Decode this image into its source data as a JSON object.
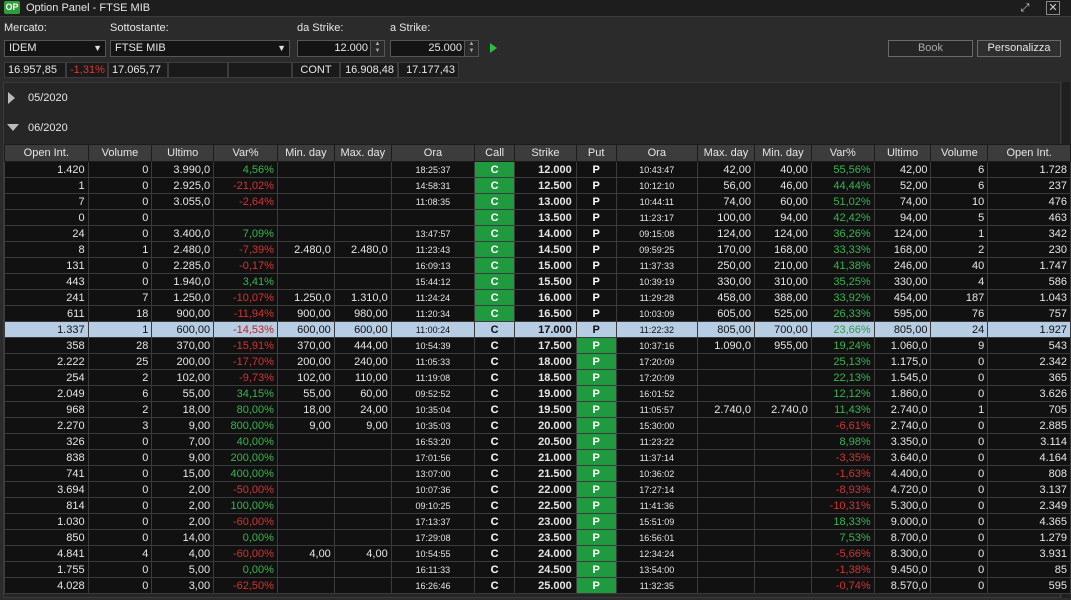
{
  "window": {
    "title": "Option Panel - FTSE MIB",
    "app_icon": "OP"
  },
  "filters": {
    "mercato_label": "Mercato:",
    "mercato_value": "IDEM",
    "sottostante_label": "Sottostante:",
    "sottostante_value": "FTSE MIB",
    "da_strike_label": "da Strike:",
    "da_strike_value": "12.000",
    "a_strike_label": "a Strike:",
    "a_strike_value": "25.000",
    "book_label": "Book",
    "personalizza_label": "Personalizza"
  },
  "quote": {
    "last": "16.957,85",
    "change": "-1,31%",
    "ref": "17.065,77",
    "cont_label": "CONT",
    "bid": "16.908,48",
    "ask": "17.177,43"
  },
  "expiries": [
    {
      "label": "05/2020",
      "expanded": false
    },
    {
      "label": "06/2020",
      "expanded": true
    }
  ],
  "columns": [
    "Open Int.",
    "Volume",
    "Ultimo",
    "Var%",
    "Min. day",
    "Max. day",
    "Ora",
    "Call",
    "Strike",
    "Put",
    "Ora",
    "Max. day",
    "Min. day",
    "Var%",
    "Ultimo",
    "Volume",
    "Open Int."
  ],
  "rows": [
    {
      "c_oi": "1.420",
      "c_vol": "0",
      "c_last": "3.990,0",
      "c_var": "4,56%",
      "c_min": "",
      "c_max": "",
      "c_time": "18:25:37",
      "call": "C",
      "call_itm": true,
      "strike": "12.000",
      "put": "P",
      "put_itm": false,
      "p_time": "10:43:47",
      "p_max": "42,00",
      "p_min": "40,00",
      "p_var": "55,56%",
      "p_last": "42,00",
      "p_vol": "6",
      "p_oi": "1.728"
    },
    {
      "c_oi": "1",
      "c_vol": "0",
      "c_last": "2.925,0",
      "c_var": "-21,02%",
      "c_min": "",
      "c_max": "",
      "c_time": "14:58:31",
      "call": "C",
      "call_itm": true,
      "strike": "12.500",
      "put": "P",
      "put_itm": false,
      "p_time": "10:12:10",
      "p_max": "56,00",
      "p_min": "46,00",
      "p_var": "44,44%",
      "p_last": "52,00",
      "p_vol": "6",
      "p_oi": "237"
    },
    {
      "c_oi": "7",
      "c_vol": "0",
      "c_last": "3.055,0",
      "c_var": "-2,64%",
      "c_min": "",
      "c_max": "",
      "c_time": "11:08:35",
      "call": "C",
      "call_itm": true,
      "strike": "13.000",
      "put": "P",
      "put_itm": false,
      "p_time": "10:44:11",
      "p_max": "74,00",
      "p_min": "60,00",
      "p_var": "51,02%",
      "p_last": "74,00",
      "p_vol": "10",
      "p_oi": "476"
    },
    {
      "c_oi": "0",
      "c_vol": "0",
      "c_last": "",
      "c_var": "",
      "c_min": "",
      "c_max": "",
      "c_time": "",
      "call": "C",
      "call_itm": true,
      "strike": "13.500",
      "put": "P",
      "put_itm": false,
      "p_time": "11:23:17",
      "p_max": "100,00",
      "p_min": "94,00",
      "p_var": "42,42%",
      "p_last": "94,00",
      "p_vol": "5",
      "p_oi": "463"
    },
    {
      "c_oi": "24",
      "c_vol": "0",
      "c_last": "3.400,0",
      "c_var": "7,09%",
      "c_min": "",
      "c_max": "",
      "c_time": "13:47:57",
      "call": "C",
      "call_itm": true,
      "strike": "14.000",
      "put": "P",
      "put_itm": false,
      "p_time": "09:15:08",
      "p_max": "124,00",
      "p_min": "124,00",
      "p_var": "36,26%",
      "p_last": "124,00",
      "p_vol": "1",
      "p_oi": "342"
    },
    {
      "c_oi": "8",
      "c_vol": "1",
      "c_last": "2.480,0",
      "c_var": "-7,39%",
      "c_min": "2.480,0",
      "c_max": "2.480,0",
      "c_time": "11:23:43",
      "call": "C",
      "call_itm": true,
      "strike": "14.500",
      "put": "P",
      "put_itm": false,
      "p_time": "09:59:25",
      "p_max": "170,00",
      "p_min": "168,00",
      "p_var": "33,33%",
      "p_last": "168,00",
      "p_vol": "2",
      "p_oi": "230"
    },
    {
      "c_oi": "131",
      "c_vol": "0",
      "c_last": "2.285,0",
      "c_var": "-0,17%",
      "c_min": "",
      "c_max": "",
      "c_time": "16:09:13",
      "call": "C",
      "call_itm": true,
      "strike": "15.000",
      "put": "P",
      "put_itm": false,
      "p_time": "11:37:33",
      "p_max": "250,00",
      "p_min": "210,00",
      "p_var": "41,38%",
      "p_last": "246,00",
      "p_vol": "40",
      "p_oi": "1.747"
    },
    {
      "c_oi": "443",
      "c_vol": "0",
      "c_last": "1.940,0",
      "c_var": "3,41%",
      "c_min": "",
      "c_max": "",
      "c_time": "15:44:12",
      "call": "C",
      "call_itm": true,
      "strike": "15.500",
      "put": "P",
      "put_itm": false,
      "p_time": "10:39:19",
      "p_max": "330,00",
      "p_min": "310,00",
      "p_var": "35,25%",
      "p_last": "330,00",
      "p_vol": "4",
      "p_oi": "586"
    },
    {
      "c_oi": "241",
      "c_vol": "7",
      "c_last": "1.250,0",
      "c_var": "-10,07%",
      "c_min": "1.250,0",
      "c_max": "1.310,0",
      "c_time": "11:24:24",
      "call": "C",
      "call_itm": true,
      "strike": "16.000",
      "put": "P",
      "put_itm": false,
      "p_time": "11:29:28",
      "p_max": "458,00",
      "p_min": "388,00",
      "p_var": "33,92%",
      "p_last": "454,00",
      "p_vol": "187",
      "p_oi": "1.043"
    },
    {
      "c_oi": "611",
      "c_vol": "18",
      "c_last": "900,00",
      "c_var": "-11,94%",
      "c_min": "900,00",
      "c_max": "980,00",
      "c_time": "11:20:34",
      "call": "C",
      "call_itm": true,
      "strike": "16.500",
      "put": "P",
      "put_itm": false,
      "p_time": "10:03:09",
      "p_max": "605,00",
      "p_min": "525,00",
      "p_var": "26,33%",
      "p_last": "595,00",
      "p_vol": "76",
      "p_oi": "757"
    },
    {
      "c_oi": "1.337",
      "c_vol": "1",
      "c_last": "600,00",
      "c_var": "-14,53%",
      "c_min": "600,00",
      "c_max": "600,00",
      "c_time": "11:00:24",
      "call": "C",
      "call_itm": false,
      "strike": "17.000",
      "put": "P",
      "put_itm": false,
      "p_time": "11:22:32",
      "p_max": "805,00",
      "p_min": "700,00",
      "p_var": "23,66%",
      "p_last": "805,00",
      "p_vol": "24",
      "p_oi": "1.927",
      "selected": true
    },
    {
      "c_oi": "358",
      "c_vol": "28",
      "c_last": "370,00",
      "c_var": "-15,91%",
      "c_min": "370,00",
      "c_max": "444,00",
      "c_time": "10:54:39",
      "call": "C",
      "call_itm": false,
      "strike": "17.500",
      "put": "P",
      "put_itm": true,
      "p_time": "10:37:16",
      "p_max": "1.090,0",
      "p_min": "955,00",
      "p_var": "19,24%",
      "p_last": "1.060,0",
      "p_vol": "9",
      "p_oi": "543"
    },
    {
      "c_oi": "2.222",
      "c_vol": "25",
      "c_last": "200,00",
      "c_var": "-17,70%",
      "c_min": "200,00",
      "c_max": "240,00",
      "c_time": "11:05:33",
      "call": "C",
      "call_itm": false,
      "strike": "18.000",
      "put": "P",
      "put_itm": true,
      "p_time": "17:20:09",
      "p_max": "",
      "p_min": "",
      "p_var": "25,13%",
      "p_last": "1.175,0",
      "p_vol": "0",
      "p_oi": "2.342"
    },
    {
      "c_oi": "254",
      "c_vol": "2",
      "c_last": "102,00",
      "c_var": "-9,73%",
      "c_min": "102,00",
      "c_max": "110,00",
      "c_time": "11:19:08",
      "call": "C",
      "call_itm": false,
      "strike": "18.500",
      "put": "P",
      "put_itm": true,
      "p_time": "17:20:09",
      "p_max": "",
      "p_min": "",
      "p_var": "22,13%",
      "p_last": "1.545,0",
      "p_vol": "0",
      "p_oi": "365"
    },
    {
      "c_oi": "2.049",
      "c_vol": "6",
      "c_last": "55,00",
      "c_var": "34,15%",
      "c_min": "55,00",
      "c_max": "60,00",
      "c_time": "09:52:52",
      "call": "C",
      "call_itm": false,
      "strike": "19.000",
      "put": "P",
      "put_itm": true,
      "p_time": "16:01:52",
      "p_max": "",
      "p_min": "",
      "p_var": "12,12%",
      "p_last": "1.860,0",
      "p_vol": "0",
      "p_oi": "3.626"
    },
    {
      "c_oi": "968",
      "c_vol": "2",
      "c_last": "18,00",
      "c_var": "80,00%",
      "c_min": "18,00",
      "c_max": "24,00",
      "c_time": "10:35:04",
      "call": "C",
      "call_itm": false,
      "strike": "19.500",
      "put": "P",
      "put_itm": true,
      "p_time": "11:05:57",
      "p_max": "2.740,0",
      "p_min": "2.740,0",
      "p_var": "11,43%",
      "p_last": "2.740,0",
      "p_vol": "1",
      "p_oi": "705"
    },
    {
      "c_oi": "2.270",
      "c_vol": "3",
      "c_last": "9,00",
      "c_var": "800,00%",
      "c_min": "9,00",
      "c_max": "9,00",
      "c_time": "10:35:03",
      "call": "C",
      "call_itm": false,
      "strike": "20.000",
      "put": "P",
      "put_itm": true,
      "p_time": "15:30:00",
      "p_max": "",
      "p_min": "",
      "p_var": "-6,61%",
      "p_last": "2.740,0",
      "p_vol": "0",
      "p_oi": "2.885"
    },
    {
      "c_oi": "326",
      "c_vol": "0",
      "c_last": "7,00",
      "c_var": "40,00%",
      "c_min": "",
      "c_max": "",
      "c_time": "16:53:20",
      "call": "C",
      "call_itm": false,
      "strike": "20.500",
      "put": "P",
      "put_itm": true,
      "p_time": "11:23:22",
      "p_max": "",
      "p_min": "",
      "p_var": "8,98%",
      "p_last": "3.350,0",
      "p_vol": "0",
      "p_oi": "3.114"
    },
    {
      "c_oi": "838",
      "c_vol": "0",
      "c_last": "9,00",
      "c_var": "200,00%",
      "c_min": "",
      "c_max": "",
      "c_time": "17:01:56",
      "call": "C",
      "call_itm": false,
      "strike": "21.000",
      "put": "P",
      "put_itm": true,
      "p_time": "11:37:14",
      "p_max": "",
      "p_min": "",
      "p_var": "-3,35%",
      "p_last": "3.640,0",
      "p_vol": "0",
      "p_oi": "4.164"
    },
    {
      "c_oi": "741",
      "c_vol": "0",
      "c_last": "15,00",
      "c_var": "400,00%",
      "c_min": "",
      "c_max": "",
      "c_time": "13:07:00",
      "call": "C",
      "call_itm": false,
      "strike": "21.500",
      "put": "P",
      "put_itm": true,
      "p_time": "10:36:02",
      "p_max": "",
      "p_min": "",
      "p_var": "-1,63%",
      "p_last": "4.400,0",
      "p_vol": "0",
      "p_oi": "808"
    },
    {
      "c_oi": "3.694",
      "c_vol": "0",
      "c_last": "2,00",
      "c_var": "-50,00%",
      "c_min": "",
      "c_max": "",
      "c_time": "10:07:36",
      "call": "C",
      "call_itm": false,
      "strike": "22.000",
      "put": "P",
      "put_itm": true,
      "p_time": "17:27:14",
      "p_max": "",
      "p_min": "",
      "p_var": "-8,93%",
      "p_last": "4.720,0",
      "p_vol": "0",
      "p_oi": "3.137"
    },
    {
      "c_oi": "814",
      "c_vol": "0",
      "c_last": "2,00",
      "c_var": "100,00%",
      "c_min": "",
      "c_max": "",
      "c_time": "09:10:25",
      "call": "C",
      "call_itm": false,
      "strike": "22.500",
      "put": "P",
      "put_itm": true,
      "p_time": "11:41:36",
      "p_max": "",
      "p_min": "",
      "p_var": "-10,31%",
      "p_last": "5.300,0",
      "p_vol": "0",
      "p_oi": "2.349"
    },
    {
      "c_oi": "1.030",
      "c_vol": "0",
      "c_last": "2,00",
      "c_var": "-60,00%",
      "c_min": "",
      "c_max": "",
      "c_time": "17:13:37",
      "call": "C",
      "call_itm": false,
      "strike": "23.000",
      "put": "P",
      "put_itm": true,
      "p_time": "15:51:09",
      "p_max": "",
      "p_min": "",
      "p_var": "18,33%",
      "p_last": "9.000,0",
      "p_vol": "0",
      "p_oi": "4.365"
    },
    {
      "c_oi": "850",
      "c_vol": "0",
      "c_last": "14,00",
      "c_var": "0,00%",
      "c_min": "",
      "c_max": "",
      "c_time": "17:29:08",
      "call": "C",
      "call_itm": false,
      "strike": "23.500",
      "put": "P",
      "put_itm": true,
      "p_time": "16:56:01",
      "p_max": "",
      "p_min": "",
      "p_var": "7,53%",
      "p_last": "8.700,0",
      "p_vol": "0",
      "p_oi": "1.279"
    },
    {
      "c_oi": "4.841",
      "c_vol": "4",
      "c_last": "4,00",
      "c_var": "-60,00%",
      "c_min": "4,00",
      "c_max": "4,00",
      "c_time": "10:54:55",
      "call": "C",
      "call_itm": false,
      "strike": "24.000",
      "put": "P",
      "put_itm": true,
      "p_time": "12:34:24",
      "p_max": "",
      "p_min": "",
      "p_var": "-5,66%",
      "p_last": "8.300,0",
      "p_vol": "0",
      "p_oi": "3.931"
    },
    {
      "c_oi": "1.755",
      "c_vol": "0",
      "c_last": "5,00",
      "c_var": "0,00%",
      "c_min": "",
      "c_max": "",
      "c_time": "16:11:33",
      "call": "C",
      "call_itm": false,
      "strike": "24.500",
      "put": "P",
      "put_itm": true,
      "p_time": "13:54:00",
      "p_max": "",
      "p_min": "",
      "p_var": "-1,38%",
      "p_last": "9.450,0",
      "p_vol": "0",
      "p_oi": "85"
    },
    {
      "c_oi": "4.028",
      "c_vol": "0",
      "c_last": "3,00",
      "c_var": "-62,50%",
      "c_min": "",
      "c_max": "",
      "c_time": "16:26:46",
      "call": "C",
      "call_itm": false,
      "strike": "25.000",
      "put": "P",
      "put_itm": true,
      "p_time": "11:32:35",
      "p_max": "",
      "p_min": "",
      "p_var": "-0,74%",
      "p_last": "8.570,0",
      "p_vol": "0",
      "p_oi": "595"
    }
  ],
  "colors": {
    "positive": "#36b64c",
    "negative": "#d33232",
    "itm": "#1f9a3f",
    "selected_row": "#b6cde4"
  }
}
